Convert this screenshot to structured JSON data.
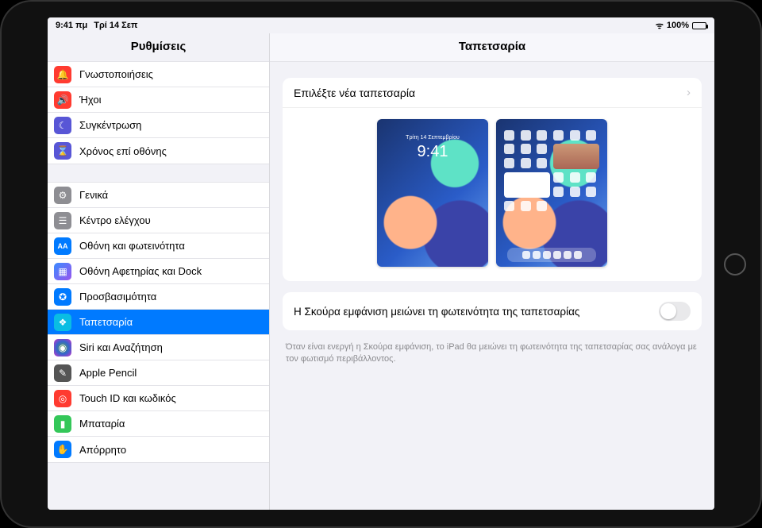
{
  "status": {
    "time": "9:41 πμ",
    "date": "Τρί 14 Σεπ",
    "battery_pct": "100%"
  },
  "sidebar": {
    "title": "Ρυθμίσεις",
    "group1": [
      {
        "label": "Γνωστοποιήσεις",
        "icon": "ic-red",
        "glyph": "🔔"
      },
      {
        "label": "Ήχοι",
        "icon": "ic-red2",
        "glyph": "🔊"
      },
      {
        "label": "Συγκέντρωση",
        "icon": "ic-indigo",
        "glyph": "☾"
      },
      {
        "label": "Χρόνος επί οθόνης",
        "icon": "ic-indigo",
        "glyph": "⌛"
      }
    ],
    "group2": [
      {
        "label": "Γενικά",
        "icon": "ic-gray",
        "glyph": "⚙"
      },
      {
        "label": "Κέντρο ελέγχου",
        "icon": "ic-gray",
        "glyph": "☰"
      },
      {
        "label": "Οθόνη και φωτεινότητα",
        "icon": "ic-blue",
        "glyph": "AA"
      },
      {
        "label": "Οθόνη Αφετηρίας και Dock",
        "icon": "ic-grad",
        "glyph": "▦"
      },
      {
        "label": "Προσβασιμότητα",
        "icon": "ic-blue",
        "glyph": "✪"
      },
      {
        "label": "Ταπετσαρία",
        "icon": "ic-cyan",
        "glyph": "❖",
        "selected": true
      },
      {
        "label": "Siri και Αναζήτηση",
        "icon": "ic-siri",
        "glyph": "◉"
      },
      {
        "label": "Apple Pencil",
        "icon": "ic-dark",
        "glyph": "✎"
      },
      {
        "label": "Touch ID και κωδικός",
        "icon": "ic-red",
        "glyph": "◎"
      },
      {
        "label": "Μπαταρία",
        "icon": "ic-green",
        "glyph": "▮"
      },
      {
        "label": "Απόρρητο",
        "icon": "ic-blue",
        "glyph": "✋"
      }
    ]
  },
  "detail": {
    "title": "Ταπετσαρία",
    "choose_label": "Επιλέξτε νέα ταπετσαρία",
    "lock_preview": {
      "time": "9:41",
      "date": "Τρίτη 14 Σεπτεμβρίου"
    },
    "dark_dim": {
      "label": "Η Σκούρα εμφάνιση μειώνει τη φωτεινότητα της ταπετσαρίας",
      "enabled": false
    },
    "footer": "Όταν είναι ενεργή η Σκούρα εμφάνιση, το iPad θα μειώνει τη φωτεινότητα της ταπετσαρίας σας ανάλογα με τον φωτισμό περιβάλλοντος."
  }
}
